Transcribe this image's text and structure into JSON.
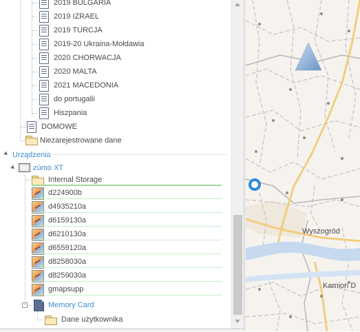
{
  "tree": {
    "items": [
      {
        "label": "2019 BULGARIA"
      },
      {
        "label": "2019 IZRAEL"
      },
      {
        "label": "2019 TURCJA"
      },
      {
        "label": "2019-20 Ukraina-Mołdawia"
      },
      {
        "label": "2020 CHORWACJA"
      },
      {
        "label": "2020 MALTA"
      },
      {
        "label": "2021 MACEDONIA"
      },
      {
        "label": "do portugalii"
      },
      {
        "label": "Hiszpania"
      }
    ],
    "domowe": "DOMOWE",
    "unregistered": "Niezarejestrowane dane",
    "devices_section": "Urządzenia",
    "device": "zūmo XT",
    "internal_storage": "Internal Storage",
    "map_files": [
      "d224900b",
      "d4935210a",
      "d6159130a",
      "d6210130a",
      "d6559120a",
      "d8258030a",
      "d8259030a",
      "gmapsupp"
    ],
    "memory_card": "Memory Card",
    "user_data": "Dane użytkownika"
  },
  "map": {
    "labels": {
      "town1": "Wyszogród",
      "town2": "Kamion D"
    },
    "colors": {
      "background": "#f6f3ef",
      "major_road": "#f2cd7e",
      "minor_road": "#c2c2c2",
      "river": "#c6d9ef",
      "marker": "#2e8ad8"
    }
  }
}
